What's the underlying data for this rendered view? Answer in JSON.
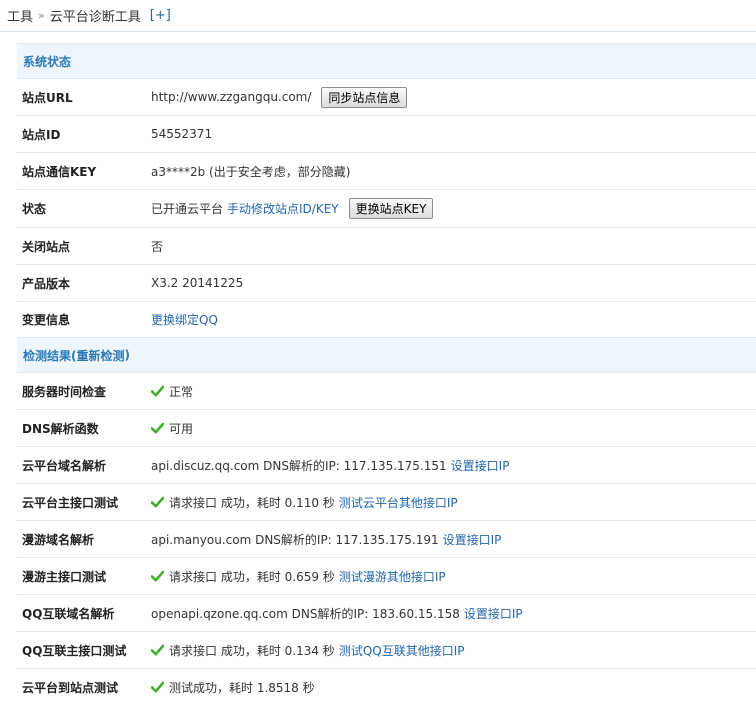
{
  "breadcrumb": {
    "root": "工具",
    "separator": "»",
    "current": "云平台诊断工具",
    "toggle": "[+]"
  },
  "status_section": {
    "title": "系统状态",
    "site_url": {
      "label": "站点URL",
      "value": "http://www.zzgangqu.com/",
      "button": "同步站点信息"
    },
    "site_id": {
      "label": "站点ID",
      "value": "54552371"
    },
    "site_key": {
      "label": "站点通信KEY",
      "value": "a3****2b (出于安全考虑，部分隐藏)"
    },
    "state": {
      "label": "状态",
      "value": "已开通云平台",
      "link": "手动修改站点ID/KEY",
      "button": "更换站点KEY"
    },
    "closed": {
      "label": "关闭站点",
      "value": "否"
    },
    "version": {
      "label": "产品版本",
      "value": "X3.2 20141225"
    },
    "change": {
      "label": "变更信息",
      "link": "更换绑定QQ"
    }
  },
  "check_section": {
    "title_prefix": "检测结果(",
    "title_link": "重新检测",
    "title_suffix": ")",
    "server_time": {
      "label": "服务器时间检查",
      "value": "正常"
    },
    "dns_func": {
      "label": "DNS解析函数",
      "value": "可用"
    },
    "cloud_dns": {
      "label": "云平台域名解析",
      "value": "api.discuz.qq.com DNS解析的IP: 117.135.175.151",
      "link": "设置接口IP"
    },
    "cloud_api": {
      "label": "云平台主接口测试",
      "value": "请求接口 成功，耗时 0.110 秒",
      "link": "测试云平台其他接口IP"
    },
    "manyou_dns": {
      "label": "漫游域名解析",
      "value": "api.manyou.com DNS解析的IP: 117.135.175.191",
      "link": "设置接口IP"
    },
    "manyou_api": {
      "label": "漫游主接口测试",
      "value": "请求接口 成功，耗时 0.659 秒",
      "link": "测试漫游其他接口IP"
    },
    "qq_dns": {
      "label": "QQ互联域名解析",
      "value": "openapi.qzone.qq.com DNS解析的IP: 183.60.15.158",
      "link": "设置接口IP"
    },
    "qq_api": {
      "label": "QQ互联主接口测试",
      "value": "请求接口 成功，耗时 0.134 秒",
      "link": "测试QQ互联其他接口IP"
    },
    "cloud_site": {
      "label": "云平台到站点测试",
      "value": "测试成功，耗时 1.8518 秒"
    }
  },
  "colors": {
    "accent": "#2b7ab8",
    "link": "#2366a8",
    "check": "#3fae2a",
    "section_bg": "#eef5fb"
  },
  "icons": {
    "check": "check-icon"
  }
}
